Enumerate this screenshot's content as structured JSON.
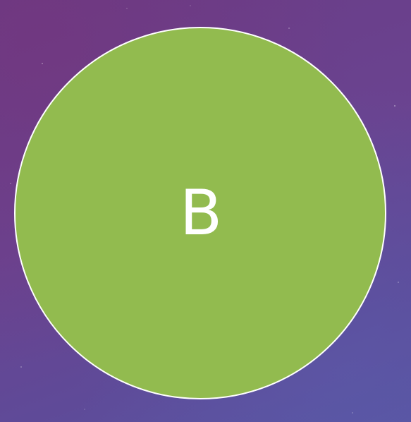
{
  "slide": {
    "circle_letter": "B",
    "circle_color": "#92bb4f",
    "circle_border_color": "#ffffff",
    "text_color": "#ffffff",
    "background_colors": [
      "#6a3c86",
      "#6a4390",
      "#5f4a98",
      "#5a55a2"
    ]
  }
}
